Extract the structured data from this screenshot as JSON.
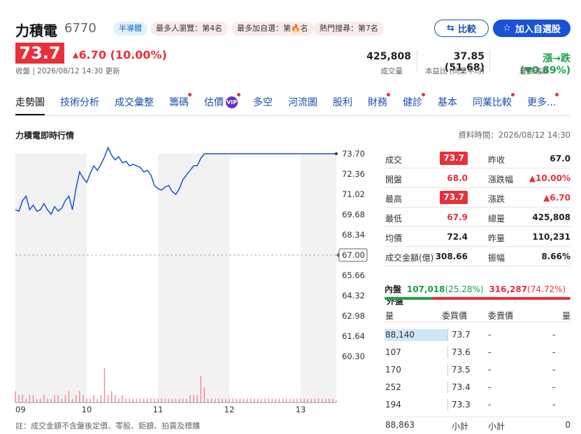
{
  "header": {
    "name": "力積電",
    "code": "6770",
    "tags": [
      "半導體",
      "最多人瀏覽：第4名",
      "最多加自選：第🔥名",
      "熱門搜尋：第7名"
    ],
    "compare_label": "比較",
    "watchlist_label": "加入自選股"
  },
  "price": {
    "last": "73.7",
    "change": "6.70 (10.00%)",
    "status": "收盤 | 2026/08/12 14:30 更新"
  },
  "stats": {
    "volume": "425,808",
    "volume_label": "成交量",
    "pe": "37.85 (51.68)",
    "pe_label": "本益比 (同業平均)",
    "breadth": "漲→跌 (▼0.89%)",
    "breadth_label": "連漲連跌"
  },
  "tabs": [
    "走勢圖",
    "技術分析",
    "成交彙整",
    "籌碼",
    "估價",
    "多空",
    "河流圖",
    "股利",
    "財務",
    "健診",
    "基本",
    "同業比較",
    "更多..."
  ],
  "vip_label": "VIP",
  "section": {
    "title": "力積電即時行情",
    "data_time": "資料時間：2026/08/12 14:30"
  },
  "chart_data": {
    "type": "line",
    "x_ticks": [
      "09",
      "10",
      "11",
      "12",
      "13"
    ],
    "y_ticks": [
      "73.70",
      "72.36",
      "71.02",
      "69.68",
      "68.34",
      "67.00",
      "65.66",
      "64.32",
      "62.98",
      "61.64",
      "60.30"
    ],
    "ylim": [
      60.3,
      73.7
    ],
    "reference_price": 67.0,
    "reference_label": "67.00",
    "series": [
      {
        "values": [
          70.0,
          69.9,
          70.6,
          70.9,
          70.0,
          70.3,
          69.9,
          70.0,
          70.4,
          70.0,
          69.7,
          70.2,
          69.9,
          70.1,
          70.6,
          70.9,
          70.0,
          71.4,
          72.5,
          72.1,
          71.8,
          72.4,
          72.9,
          72.6,
          73.0,
          73.5,
          74.1,
          73.6,
          73.3,
          73.5,
          73.1,
          73.2,
          72.9,
          73.0,
          72.9,
          72.8,
          72.5,
          72.6,
          72.3,
          71.6,
          71.4,
          71.3,
          71.5,
          71.6,
          71.2,
          71.0,
          71.4,
          72.0,
          72.3,
          72.6,
          72.9,
          72.9,
          73.4,
          73.7,
          73.7,
          73.7,
          73.7,
          73.7,
          73.7,
          73.7,
          73.7,
          73.7,
          73.7,
          73.7,
          73.7,
          73.7,
          73.7,
          73.7,
          73.7,
          73.7,
          73.7,
          73.7,
          73.7,
          73.7,
          73.7,
          73.7,
          73.7,
          73.7,
          73.7,
          73.7,
          73.7,
          73.7,
          73.7,
          73.7,
          73.7,
          73.7,
          73.7,
          73.7,
          73.7,
          73.7
        ]
      }
    ],
    "volume_bars": [
      3,
      2,
      2,
      1,
      2,
      2,
      1,
      1,
      2,
      1,
      1,
      2,
      2,
      1,
      2,
      3,
      1,
      2,
      3,
      2,
      1,
      1,
      2,
      1,
      2,
      9,
      2,
      3,
      2,
      1,
      2,
      1,
      1,
      1,
      1,
      1,
      1,
      1,
      1,
      1,
      1,
      1,
      1,
      1,
      1,
      1,
      1,
      1,
      1,
      2,
      2,
      2,
      7,
      4,
      1,
      1,
      1,
      1,
      1,
      1,
      1,
      1,
      1,
      1,
      1,
      1,
      1,
      1,
      1,
      1,
      1,
      1,
      1,
      1,
      1,
      1,
      1,
      1,
      1,
      1,
      1,
      1,
      1,
      1,
      1,
      1,
      1,
      1,
      1,
      1
    ]
  },
  "note": "註：成交金額不含盤後定價、零股、鉅額、拍賣及標購",
  "quote": {
    "rows": [
      {
        "l1": "成交",
        "v1": "73.7",
        "box1": true,
        "c1": "red",
        "l2": "昨收",
        "v2": "67.0",
        "c2": "dark"
      },
      {
        "l1": "開盤",
        "v1": "68.0",
        "box1": false,
        "c1": "red",
        "l2": "漲跌幅",
        "v2": "▲10.00%",
        "c2": "red"
      },
      {
        "l1": "最高",
        "v1": "73.7",
        "box1": true,
        "c1": "red",
        "l2": "漲跌",
        "v2": "▲6.70",
        "c2": "red"
      },
      {
        "l1": "最低",
        "v1": "67.9",
        "box1": false,
        "c1": "red",
        "l2": "總量",
        "v2": "425,808",
        "c2": "dark"
      },
      {
        "l1": "均價",
        "v1": "72.4",
        "box1": false,
        "c1": "dark",
        "l2": "昨量",
        "v2": "110,231",
        "c2": "dark"
      },
      {
        "l1": "成交金額(億)",
        "v1": "308.66",
        "box1": false,
        "c1": "dark",
        "l2": "振幅",
        "v2": "8.66%",
        "c2": "dark"
      }
    ],
    "inner_label": "內盤",
    "inner_value": "107,018",
    "inner_pct": "(25.28%)",
    "outer_value": "316,287",
    "outer_pct": "(74.72%)",
    "outer_label": "外盤",
    "inner_ratio": 0.2528
  },
  "orderbook": {
    "headers": [
      "量",
      "委買價",
      "委賣價",
      "量"
    ],
    "rows": [
      {
        "bid_vol": "88,140",
        "bid": "73.7",
        "ask": "-",
        "ask_vol": "-",
        "highlight": true
      },
      {
        "bid_vol": "107",
        "bid": "73.6",
        "ask": "-",
        "ask_vol": "-",
        "highlight": false
      },
      {
        "bid_vol": "170",
        "bid": "73.5",
        "ask": "-",
        "ask_vol": "-",
        "highlight": false
      },
      {
        "bid_vol": "252",
        "bid": "73.4",
        "ask": "-",
        "ask_vol": "-",
        "highlight": false
      },
      {
        "bid_vol": "194",
        "bid": "73.3",
        "ask": "-",
        "ask_vol": "-",
        "highlight": false
      }
    ],
    "total_bid": "88,863",
    "subtotal_label_left": "小計",
    "subtotal_label_right": "小計",
    "total_ask": "0"
  },
  "colors": {
    "up": "#e8303b",
    "down": "#1aa34a",
    "line": "#1a52d6",
    "accent": "#1a52d6"
  }
}
